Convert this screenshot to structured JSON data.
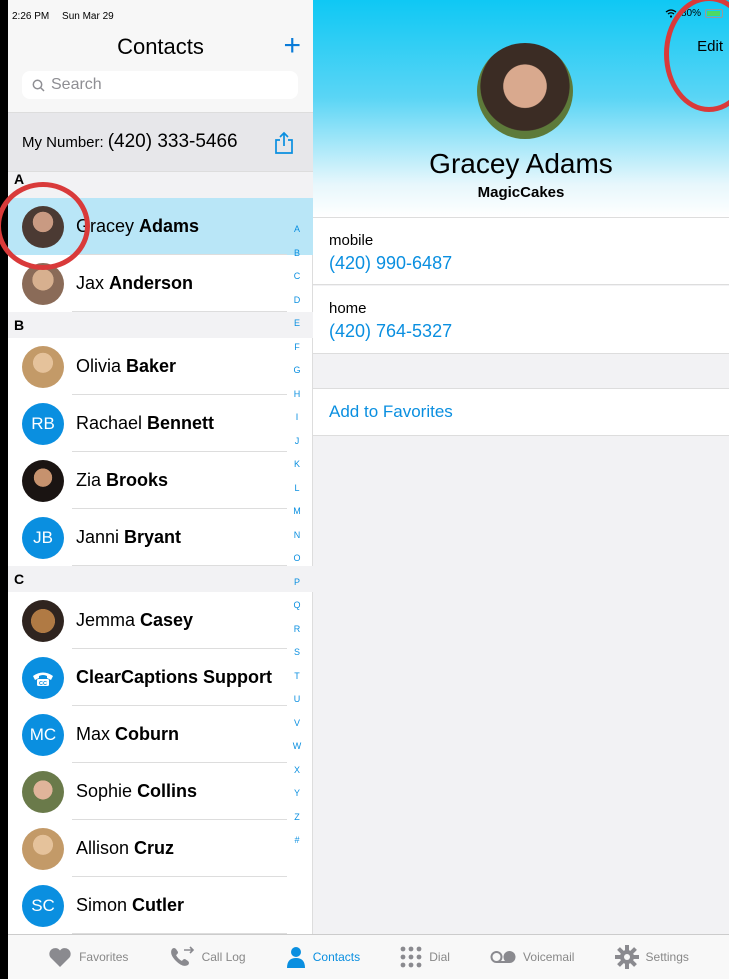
{
  "status_bar": {
    "time": "2:26 PM",
    "date": "Sun Mar 29",
    "battery": "80%"
  },
  "sidebar": {
    "title": "Contacts",
    "add_label": "+",
    "search_placeholder": "Search",
    "my_number_label": "My Number:",
    "my_number": "(420) 333-5466",
    "sections": [
      {
        "letter": "A",
        "contacts": [
          {
            "first": "Gracey",
            "last": "Adams",
            "avatar": "photo",
            "selected": true
          },
          {
            "first": "Jax",
            "last": "Anderson",
            "avatar": "photo"
          }
        ]
      },
      {
        "letter": "B",
        "contacts": [
          {
            "first": "Olivia",
            "last": "Baker",
            "avatar": "photo"
          },
          {
            "first": "Rachael",
            "last": "Bennett",
            "avatar": "initials",
            "initials": "RB"
          },
          {
            "first": "Zia",
            "last": "Brooks",
            "avatar": "photo"
          },
          {
            "first": "Janni",
            "last": "Bryant",
            "avatar": "initials",
            "initials": "JB"
          }
        ]
      },
      {
        "letter": "C",
        "contacts": [
          {
            "first": "Jemma",
            "last": "Casey",
            "avatar": "photo"
          },
          {
            "first": "",
            "last": "ClearCaptions Support",
            "avatar": "cc-icon"
          },
          {
            "first": "Max",
            "last": "Coburn",
            "avatar": "initials",
            "initials": "MC"
          },
          {
            "first": "Sophie",
            "last": "Collins",
            "avatar": "photo"
          },
          {
            "first": "Allison",
            "last": "Cruz",
            "avatar": "photo"
          },
          {
            "first": "Simon",
            "last": "Cutler",
            "avatar": "initials",
            "initials": "SC"
          }
        ]
      }
    ],
    "index_letters": [
      "A",
      "B",
      "C",
      "D",
      "E",
      "F",
      "G",
      "H",
      "I",
      "J",
      "K",
      "L",
      "M",
      "N",
      "O",
      "P",
      "Q",
      "R",
      "S",
      "T",
      "U",
      "V",
      "W",
      "X",
      "Y",
      "Z",
      "#"
    ]
  },
  "detail": {
    "edit_label": "Edit",
    "name": "Gracey Adams",
    "company": "MagicCakes",
    "fields": [
      {
        "label": "mobile",
        "value": "(420) 990-6487"
      },
      {
        "label": "home",
        "value": "(420) 764-5327"
      }
    ],
    "add_favorites_label": "Add to Favorites"
  },
  "tabbar": [
    {
      "label": "Favorites",
      "icon": "heart-icon",
      "active": false
    },
    {
      "label": "Call Log",
      "icon": "call-log-icon",
      "active": false
    },
    {
      "label": "Contacts",
      "icon": "person-icon",
      "active": true
    },
    {
      "label": "Dial",
      "icon": "keypad-icon",
      "active": false
    },
    {
      "label": "Voicemail",
      "icon": "voicemail-icon",
      "active": false
    },
    {
      "label": "Settings",
      "icon": "gear-icon",
      "active": false
    }
  ],
  "colors": {
    "accent": "#0a8fe0",
    "selected_row": "#b9e6f7",
    "annotation": "#d93a3a"
  }
}
